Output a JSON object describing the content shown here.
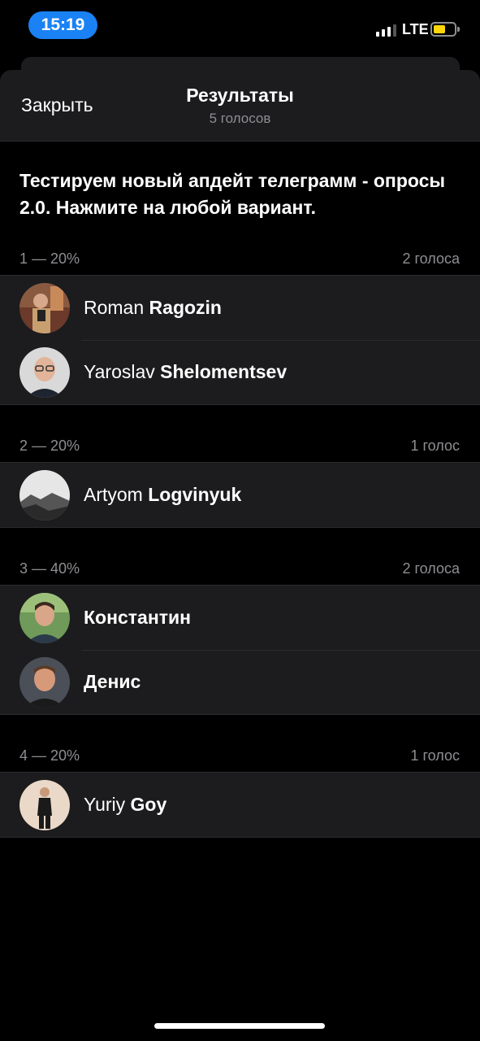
{
  "status_bar": {
    "time": "15:19",
    "network": "LTE",
    "battery_color": "#ffd60a"
  },
  "header": {
    "close_label": "Закрыть",
    "title": "Результаты",
    "subtitle": "5 голосов"
  },
  "question": "Тестируем новый апдейт телеграмм - опросы 2.0. Нажмите на любой вариант.",
  "options": [
    {
      "label": "1 — 20%",
      "count": "2 голоса",
      "voters": [
        {
          "first": "Roman",
          "last": "Ragozin"
        },
        {
          "first": "Yaroslav",
          "last": "Shelomentsev"
        }
      ]
    },
    {
      "label": "2 — 20%",
      "count": "1 голос",
      "voters": [
        {
          "first": "Artyom",
          "last": "Logvinyuk"
        }
      ]
    },
    {
      "label": "3 — 40%",
      "count": "2 голоса",
      "voters": [
        {
          "first": "Константин",
          "last": ""
        },
        {
          "first": "Денис",
          "last": ""
        }
      ]
    },
    {
      "label": "4 — 20%",
      "count": "1 голос",
      "voters": [
        {
          "first": "Yuriy",
          "last": "Goy"
        }
      ]
    }
  ],
  "colors": {
    "accent": "#1a82f4",
    "cell_bg": "#1c1c1e",
    "secondary_text": "#8e8e93"
  }
}
